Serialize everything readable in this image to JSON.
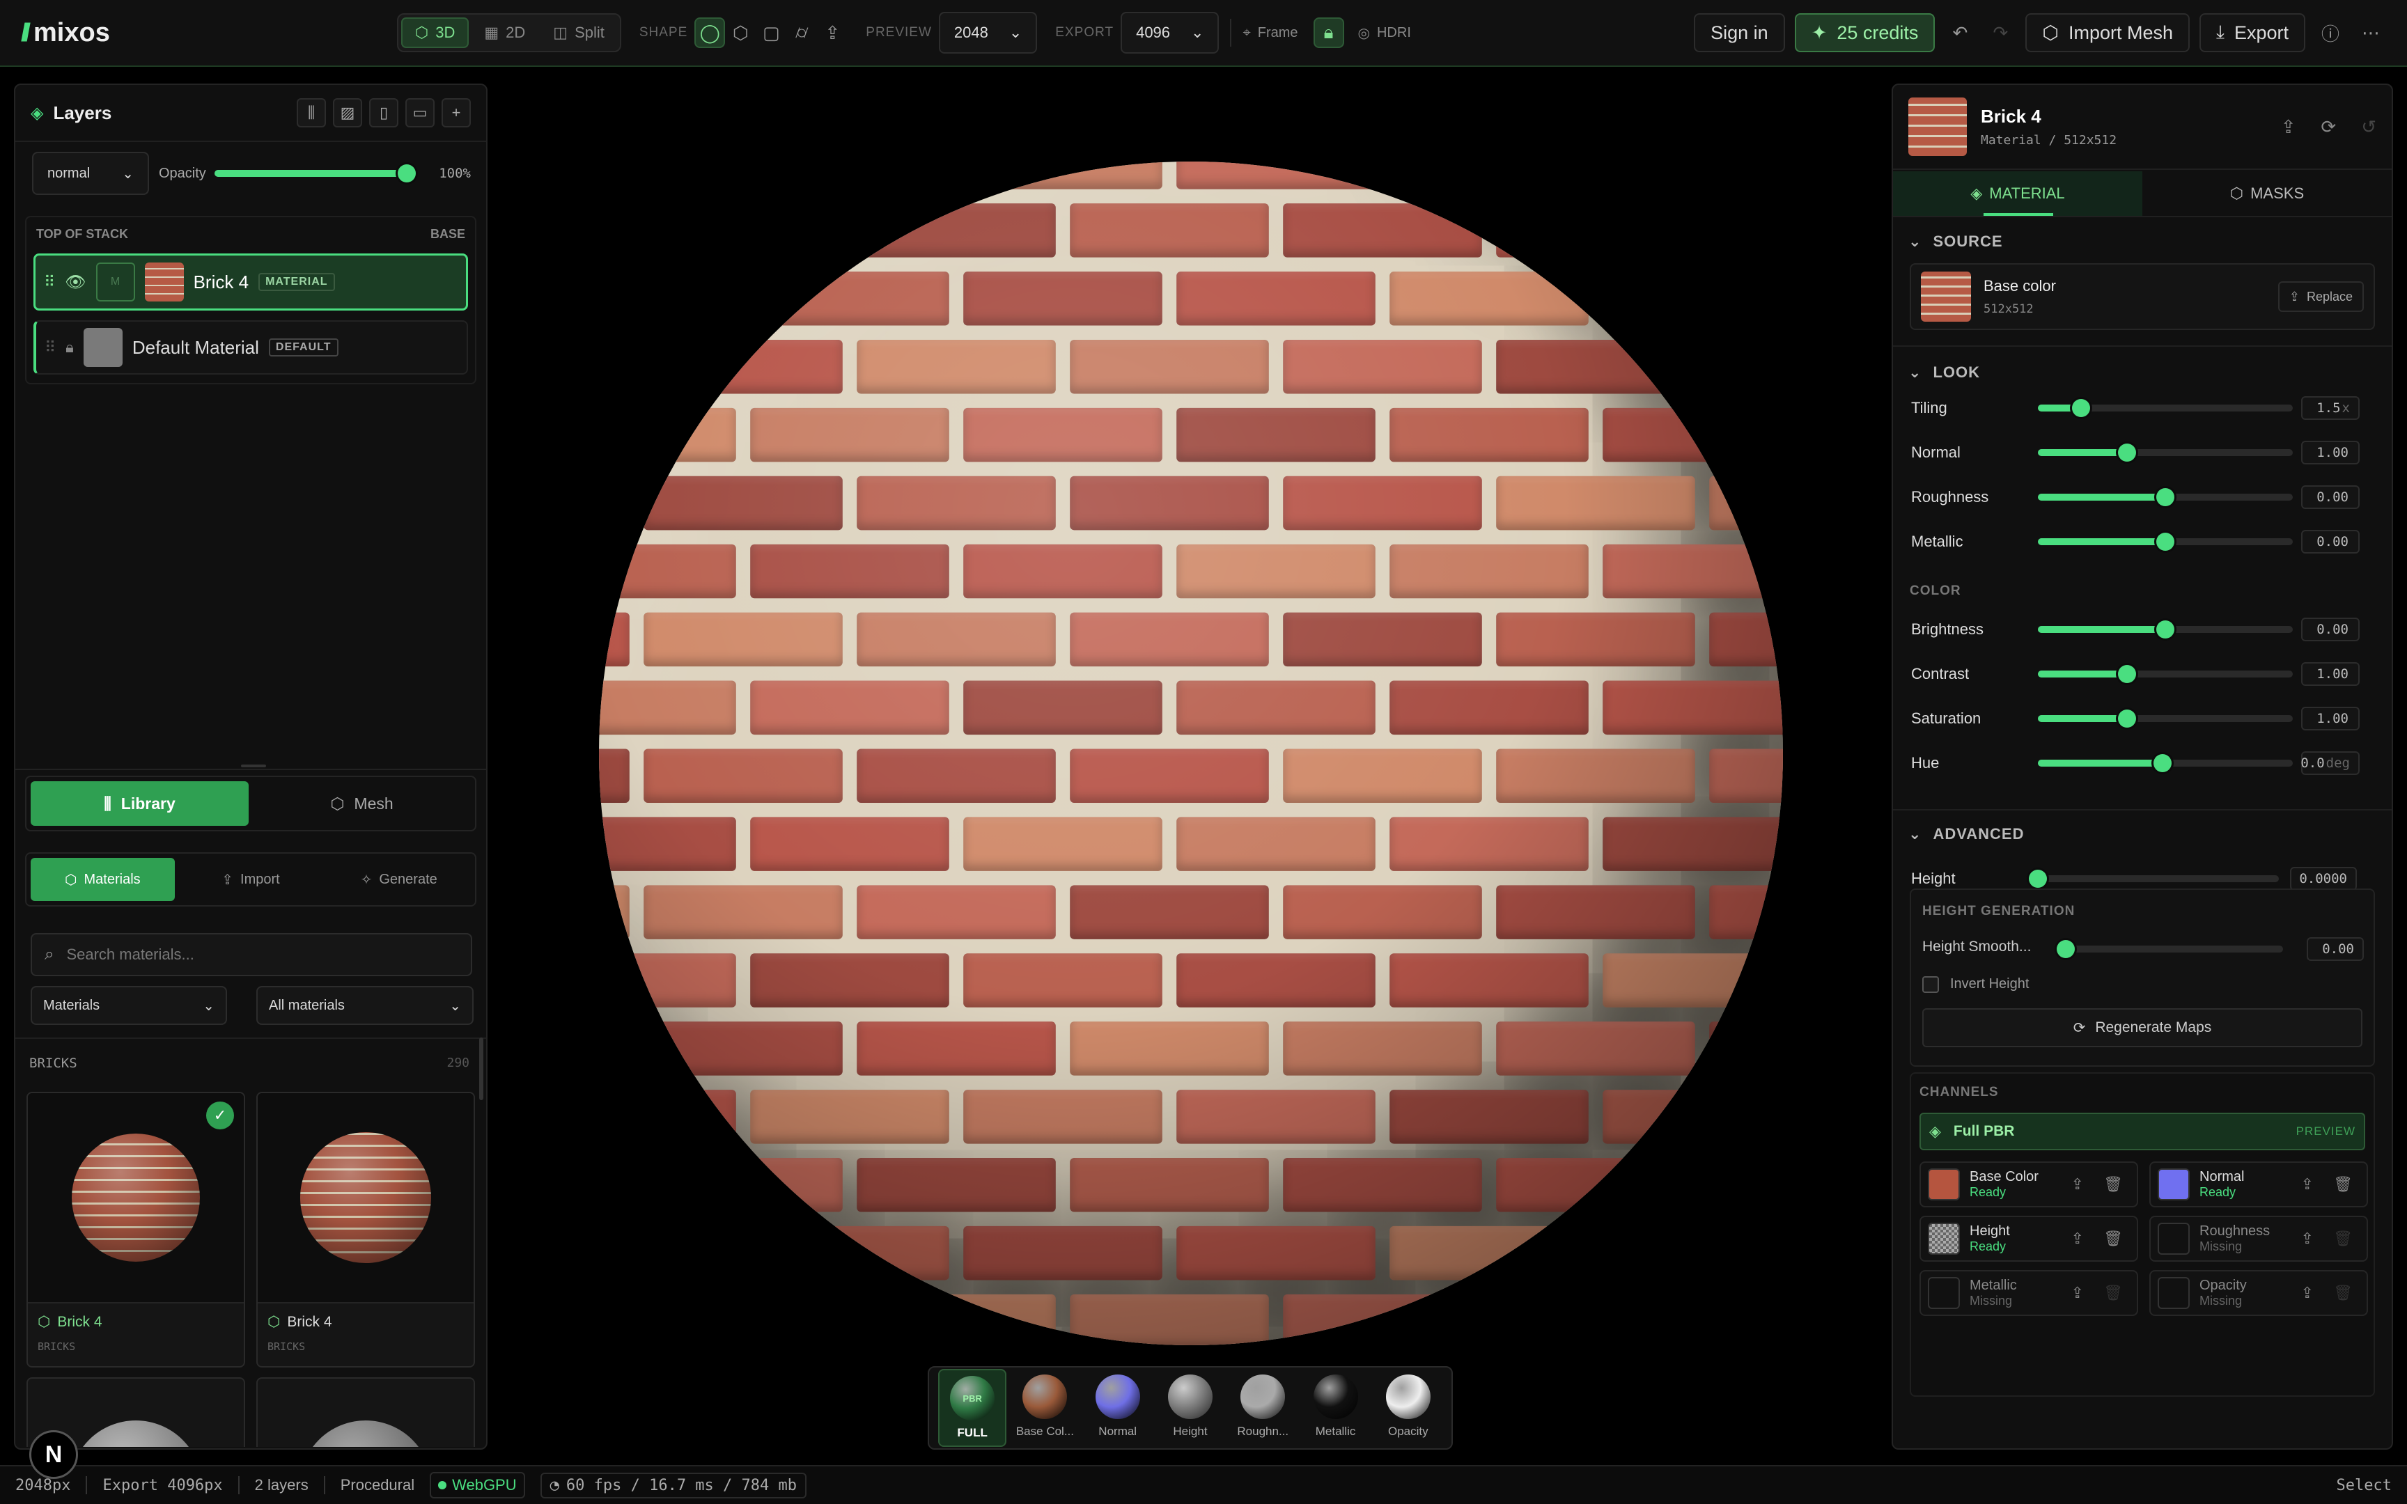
{
  "app": {
    "name": "mixos"
  },
  "topbar": {
    "view_modes": [
      "3D",
      "2D",
      "Split"
    ],
    "shape_label": "SHAPE",
    "preview_label": "PREVIEW",
    "preview_value": "2048",
    "export_label": "EXPORT",
    "export_value": "4096",
    "frame_label": "Frame",
    "hdri_label": "HDRI",
    "sign_in": "Sign in",
    "credits": "25 credits",
    "import_mesh": "Import Mesh",
    "export": "Export"
  },
  "layers": {
    "title": "Layers",
    "blend_mode": "normal",
    "opacity_label": "Opacity",
    "opacity_value": "100%",
    "opacity_fraction": 1.0,
    "top_of_stack": "TOP OF STACK",
    "base": "BASE",
    "items": [
      {
        "name": "Brick 4",
        "tag": "MATERIAL",
        "selected": true,
        "mask_letter": "M"
      },
      {
        "name": "Default Material",
        "tag": "DEFAULT",
        "selected": false
      }
    ]
  },
  "library": {
    "tabs": [
      "Library",
      "Mesh"
    ],
    "subtabs": [
      "Materials",
      "Import",
      "Generate"
    ],
    "search_placeholder": "Search materials...",
    "filter1": "Materials",
    "filter2": "All materials",
    "category": "BRICKS",
    "count": "290",
    "cards": [
      {
        "name": "Brick 4",
        "category": "BRICKS",
        "checked": true
      },
      {
        "name": "Brick 4",
        "category": "BRICKS",
        "checked": false
      }
    ]
  },
  "viewport": {
    "channel_balls": [
      {
        "label": "FULL",
        "badge": "PBR",
        "color": "#2f7a45"
      },
      {
        "label": "Base Col...",
        "color": "#9a5a3a"
      },
      {
        "label": "Normal",
        "color": "#6f6fe6"
      },
      {
        "label": "Height",
        "color": "#8a8a8a"
      },
      {
        "label": "Roughn...",
        "color": "#aaaaaa"
      },
      {
        "label": "Metallic",
        "color": "#111111"
      },
      {
        "label": "Opacity",
        "color": "#eeeeee"
      }
    ]
  },
  "inspector": {
    "title": "Brick 4",
    "subtitle": "Material / 512x512",
    "tabs": [
      "MATERIAL",
      "MASKS"
    ],
    "source": {
      "heading": "SOURCE",
      "name": "Base color",
      "size": "512x512",
      "replace": "Replace"
    },
    "look": {
      "heading": "LOOK",
      "rows": [
        {
          "label": "Tiling",
          "value": "1.5",
          "unit": "x",
          "fraction": 0.17
        },
        {
          "label": "Normal",
          "value": "1.00",
          "unit": "",
          "fraction": 0.35
        },
        {
          "label": "Roughness",
          "value": "0.00",
          "unit": "",
          "fraction": 0.5
        },
        {
          "label": "Metallic",
          "value": "0.00",
          "unit": "",
          "fraction": 0.5
        }
      ]
    },
    "color": {
      "heading": "COLOR",
      "rows": [
        {
          "label": "Brightness",
          "value": "0.00",
          "unit": "",
          "fraction": 0.5
        },
        {
          "label": "Contrast",
          "value": "1.00",
          "unit": "",
          "fraction": 0.35
        },
        {
          "label": "Saturation",
          "value": "1.00",
          "unit": "",
          "fraction": 0.35
        },
        {
          "label": "Hue",
          "value": "0.0",
          "unit": "deg",
          "fraction": 0.49
        }
      ]
    },
    "advanced": {
      "heading": "ADVANCED",
      "height_label": "Height",
      "height_value": "0.0000",
      "height_fraction": 0.0,
      "gen_heading": "HEIGHT GENERATION",
      "smooth_label": "Height Smooth...",
      "smooth_value": "0.00",
      "smooth_fraction": 0.0,
      "invert_label": "Invert Height",
      "regen": "Regenerate Maps"
    },
    "channels": {
      "heading": "CHANNELS",
      "full_pbr": "Full PBR",
      "preview": "PREVIEW",
      "items": [
        {
          "name": "Base Color",
          "status": "Ready",
          "color": "#b5553f"
        },
        {
          "name": "Normal",
          "status": "Ready",
          "color": "#7070f0"
        },
        {
          "name": "Height",
          "status": "Ready",
          "color": "#9a9a9a"
        },
        {
          "name": "Roughness",
          "status": "Missing",
          "color": "#111111"
        },
        {
          "name": "Metallic",
          "status": "Missing",
          "color": "#111111"
        },
        {
          "name": "Opacity",
          "status": "Missing",
          "color": "#111111"
        }
      ]
    }
  },
  "status": {
    "res": "2048px",
    "export": "Export 4096px",
    "layers": "2 layers",
    "mode": "Procedural",
    "gpu": "WebGPU",
    "perf": "60 fps / 16.7 ms / 784 mb",
    "tool": "Select"
  },
  "colors": {
    "accent": "#4ade80",
    "ready": "#4ade80",
    "missing": "#666666"
  }
}
